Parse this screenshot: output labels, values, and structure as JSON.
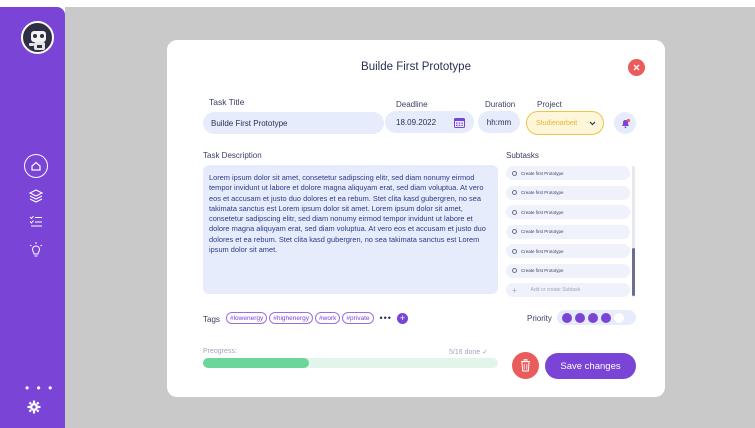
{
  "modal": {
    "title": "Builde First Prototype"
  },
  "form": {
    "task_title_label": "Task Title",
    "task_title_value": "Builde First Prototype",
    "deadline_label": "Deadline",
    "deadline_value": "18.09.2022",
    "duration_label": "Duration",
    "duration_placeholder": "hh:mm",
    "project_label": "Project",
    "project_value": "Studienarbeit",
    "description_label": "Task Description",
    "description_text": "Lorem ipsum dolor sit amet, consetetur sadipscing elitr, sed diam nonumy eirmod tempor invidunt ut labore et dolore magna aliquyam erat, sed diam voluptua. At vero eos et accusam et justo duo dolores et ea rebum. Stet clita kasd gubergren, no sea takimata sanctus est Lorem ipsum dolor sit amet. Lorem ipsum dolor sit amet, consetetur sadipscing elitr, sed diam nonumy eirmod tempor invidunt ut labore et dolore magna aliquyam erat, sed diam voluptua. At vero eos et accusam et justo duo dolores et ea rebum. Stet clita kasd gubergren, no sea takimata sanctus est Lorem ipsum dolor sit amet."
  },
  "subtasks": {
    "label": "Subtasks",
    "items": [
      "Create first Prototype",
      "Create first Prototype",
      "Create first Prototype",
      "Create first Prototype",
      "Create first Prototype",
      "Create first Prototype"
    ],
    "add_placeholder": "Add or create Subtask"
  },
  "tags": {
    "label": "Tags",
    "items": [
      "#lowenergy",
      "#highenergy",
      "#work",
      "#private"
    ],
    "more": "•••"
  },
  "priority": {
    "label": "Priority",
    "level": 4,
    "max": 5
  },
  "progress": {
    "label": "Preogress:",
    "done_text": "5/16 done ✓",
    "fraction": 0.36
  },
  "actions": {
    "save_label": "Save changes"
  },
  "sidebar": {
    "more": "• • •"
  },
  "colors": {
    "accent": "#7a44d6",
    "danger": "#ea5b5b",
    "progress": "#6cd59a",
    "project": "#f0c449"
  }
}
